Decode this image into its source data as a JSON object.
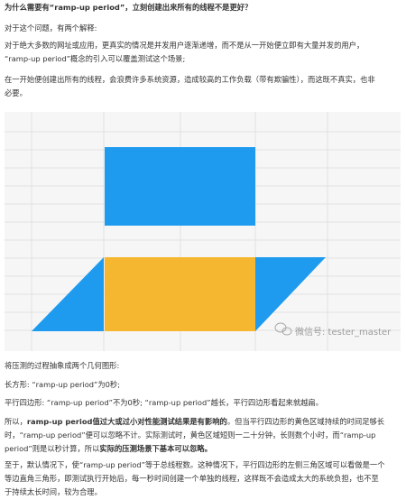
{
  "heading": "为什么需要有“ramp-up period”，立刻创建出来所有的线程不是更好？",
  "answer_intro": "对于这个问题，有两个解释:",
  "explanation_1": {
    "line1": "对于绝大多数的网址或应用，更真实的情况是并发用户逐渐递增，而不是从一开始便立即有大量并发的用户，",
    "line2": "“ramp-up period”概念的引入可以覆盖测试这个场景;"
  },
  "explanation_2": {
    "line1": "在一开始便创建出所有的线程，会浪费许多系统资源，造成较高的工作负载（带有欺骗性），而这既不真实，也非",
    "line2": "必要。"
  },
  "figure": {
    "watermark": "微信号: tester_master",
    "colors": {
      "blue": "#1e9bef",
      "orange": "#f6b730",
      "grid": "#e1e1e1",
      "background": "#f6f6f6"
    }
  },
  "abstraction": "将压测的过程抽象成两个几何图形:",
  "rectangle_def": "长方形: “ramp-up period”为0秒;",
  "parallelogram_def": "平行四边形: “ramp-up period”不为0秒; “ramp-up period”越长，平行四边形看起来就越扁。",
  "conclusion": {
    "prefix": "所以，",
    "bold1": "ramp-up period值过大或过小对性能测试结果是有影响的",
    "mid": "。但当平行四边形的黄色区域持续的时间足够长",
    "line2": "时，“ramp-up period”便可以忽略不计。实际测试时，黄色区域短则一二十分钟，长则数个小时，而“ramp-up",
    "line3_prefix": "period”则是以秒计算，所以",
    "bold2": "实际的压测场景下基本可以忽略。"
  },
  "default_note": {
    "line1": "至于，默认情况下，使“ramp-up period”等于总线程数。这种情况下，平行四边形的左侧三角区域可以看做是一个",
    "line2": "等边直角三角形，即测试执行开始后，每一秒时间创建一个单独的线程，这样既不会造成太大的系统负担，也不至",
    "line3": "于持续太长时间，较为合理。"
  }
}
